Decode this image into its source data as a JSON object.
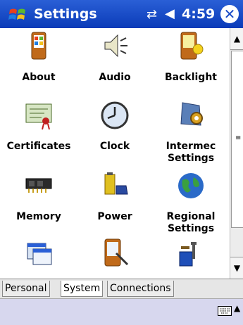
{
  "title_bar": {
    "title": "Settings",
    "time": "4:59",
    "close_label": "✕",
    "connectivity_icon": "⇄",
    "volume_icon": "◀"
  },
  "items": [
    {
      "label1": "About",
      "label2": "",
      "icon": "about-icon"
    },
    {
      "label1": "Audio",
      "label2": "",
      "icon": "audio-icon"
    },
    {
      "label1": "Backlight",
      "label2": "",
      "icon": "backlight-icon"
    },
    {
      "label1": "Certificates",
      "label2": "",
      "icon": "certificates-icon"
    },
    {
      "label1": "Clock",
      "label2": "",
      "icon": "clock-icon"
    },
    {
      "label1": "Intermec",
      "label2": "Settings",
      "icon": "intermec-settings-icon"
    },
    {
      "label1": "Memory",
      "label2": "",
      "icon": "memory-icon"
    },
    {
      "label1": "Power",
      "label2": "",
      "icon": "power-icon"
    },
    {
      "label1": "Regional",
      "label2": "Settings",
      "icon": "regional-settings-icon"
    },
    {
      "label1": "",
      "label2": "",
      "icon": "remove-programs-icon"
    },
    {
      "label1": "",
      "label2": "",
      "icon": "screen-icon"
    },
    {
      "label1": "",
      "label2": "",
      "icon": "utilities-icon"
    }
  ],
  "tabs": [
    {
      "label": "Personal"
    },
    {
      "label": "System"
    },
    {
      "label": "Connections"
    }
  ],
  "scrollbar": {
    "up": "▲",
    "down": "▼",
    "grip": "≡"
  },
  "sip": {
    "arrow": "▲"
  }
}
